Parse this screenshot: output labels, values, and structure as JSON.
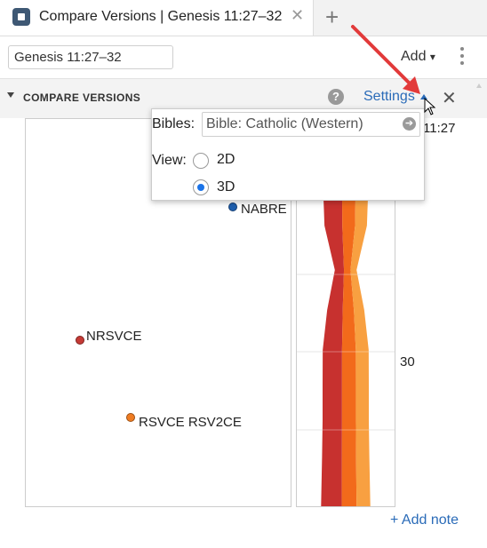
{
  "tab": {
    "title": "Compare Versions | Genesis 11:27–32",
    "close_glyph": "✕",
    "new_tab_glyph": "+",
    "icon": "document-icon"
  },
  "toolbar": {
    "reference_value": "Genesis 11:27–32",
    "add_label": "Add",
    "add_caret": "▾",
    "menu_icon": "more-vertical-icon"
  },
  "panel": {
    "title": "COMPARE VERSIONS",
    "help_glyph": "?",
    "settings_label": "Settings",
    "close_glyph": "✕"
  },
  "settings_popup": {
    "bibles_label": "Bibles:",
    "bibles_value": "Bible: Catholic (Western)",
    "go_glyph": "➔",
    "view_label": "View:",
    "options": [
      {
        "label": "2D",
        "selected": false
      },
      {
        "label": "3D",
        "selected": true
      }
    ]
  },
  "plot2d": {
    "points": [
      {
        "label": "NABRE",
        "color": "#1f5fae"
      },
      {
        "label": "NRSVCE",
        "color": "#c53a35"
      },
      {
        "label": "RSVCE RSV2CE",
        "color": "#ef7c22"
      }
    ]
  },
  "stream": {
    "top_label": "11:27",
    "mid_label": "30",
    "colors": [
      "#c7312f",
      "#f26a1b",
      "#f8a041"
    ]
  },
  "footer": {
    "add_note_label": "+ Add note"
  }
}
